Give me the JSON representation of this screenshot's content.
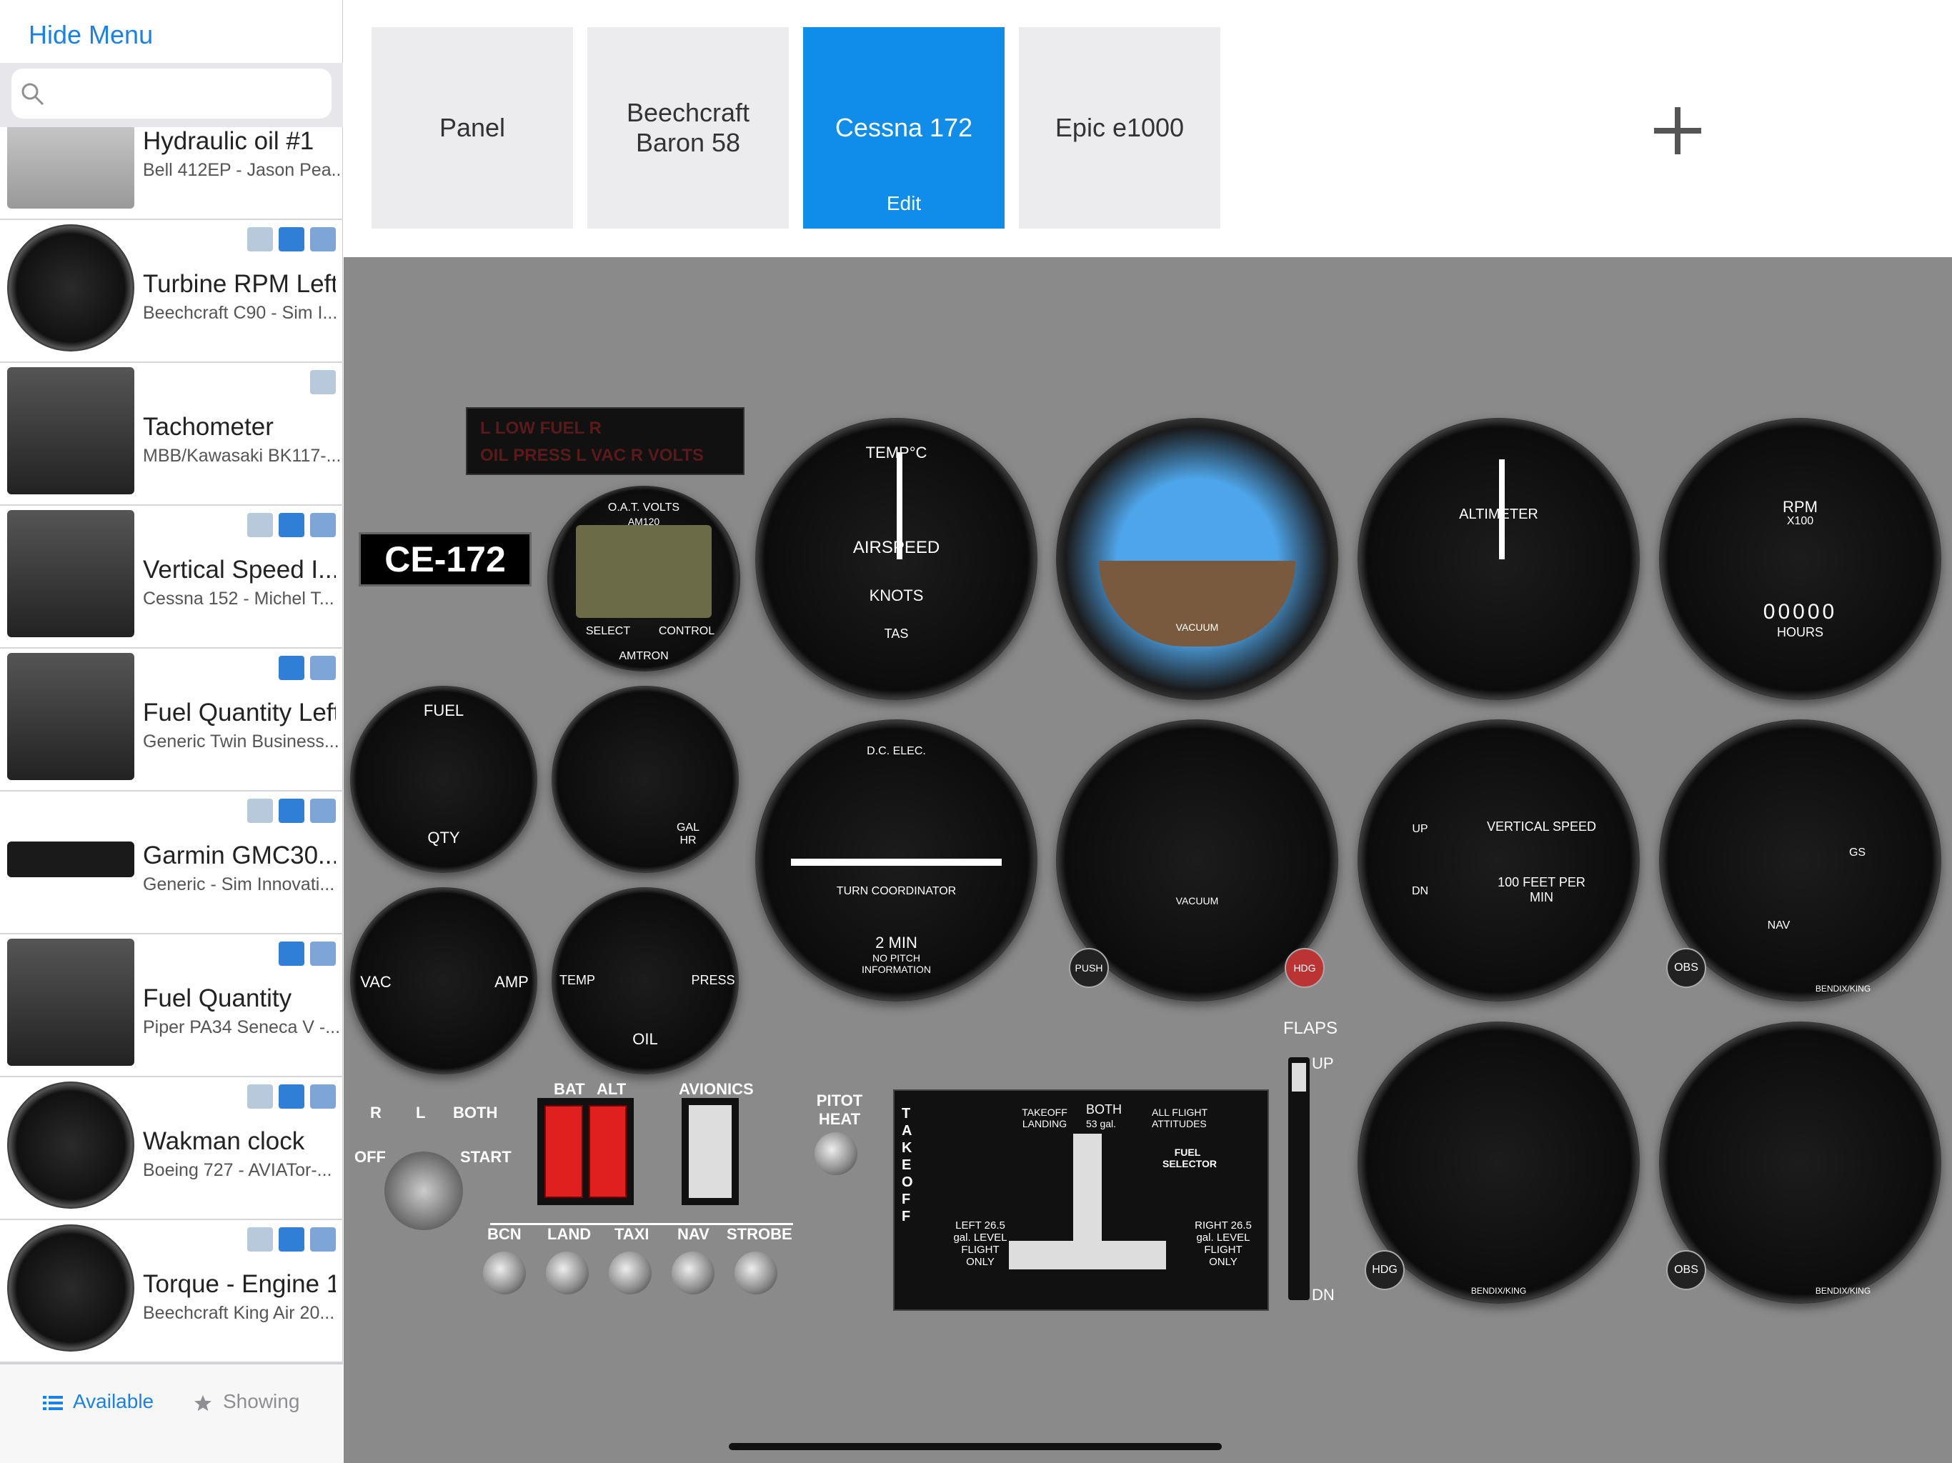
{
  "sidebar": {
    "hide_menu": "Hide Menu",
    "search_placeholder": "",
    "items": [
      {
        "title": "Hydraulic oil #1",
        "subtitle": "Bell 412EP - Jason Pea...",
        "badges": []
      },
      {
        "title": "Turbine RPM Left",
        "subtitle": "Beechcraft C90 - Sim I...",
        "badges": [
          "cloud",
          "plane",
          "p3d"
        ]
      },
      {
        "title": "Tachometer",
        "subtitle": "MBB/Kawasaki BK117-...",
        "badges": [
          "cloud"
        ]
      },
      {
        "title": "Vertical Speed I...",
        "subtitle": "Cessna 152 - Michel T...",
        "badges": [
          "cloud",
          "plane",
          "p3d"
        ]
      },
      {
        "title": "Fuel Quantity Left",
        "subtitle": "Generic Twin Business...",
        "badges": [
          "plane",
          "p3d"
        ]
      },
      {
        "title": "Garmin GMC30...",
        "subtitle": "Generic - Sim Innovati...",
        "badges": [
          "cloud",
          "plane",
          "p3d"
        ]
      },
      {
        "title": "Fuel Quantity",
        "subtitle": "Piper PA34 Seneca V -...",
        "badges": [
          "plane",
          "p3d"
        ]
      },
      {
        "title": "Wakman clock",
        "subtitle": "Boeing 727 - AVIATor-...",
        "badges": [
          "cloud",
          "plane",
          "p3d"
        ]
      },
      {
        "title": "Torque - Engine 1",
        "subtitle": "Beechcraft King Air 20...",
        "badges": [
          "cloud",
          "plane",
          "p3d"
        ]
      }
    ],
    "tabs": {
      "available": "Available",
      "showing": "Showing"
    }
  },
  "panel_tabs": [
    {
      "label": "Panel",
      "active": false
    },
    {
      "label": "Beechcraft Baron 58",
      "active": false
    },
    {
      "label": "Cessna 172",
      "active": true,
      "sub": "Edit"
    },
    {
      "label": "Epic e1000",
      "active": false
    }
  ],
  "panel": {
    "tail_label": "CE-172",
    "annunciator": {
      "line1": "L  LOW FUEL  R",
      "line2": "OIL PRESS  L  VAC  R  VOLTS"
    },
    "am120": {
      "top": "O.A.T.   VOLTS",
      "model": "AM120",
      "select": "SELECT",
      "control": "CONTROL",
      "brand": "AMTRON"
    },
    "gauges": {
      "airspeed": {
        "l1": "TEMP°C",
        "l2": "AIRSPEED",
        "l3": "KNOTS",
        "l4": "TAS"
      },
      "attitude": {
        "l1": "VACUUM"
      },
      "altimeter": {
        "l1": "ALTIMETER"
      },
      "tach": {
        "l1": "RPM",
        "l2": "X100",
        "l3": "HOURS",
        "counter": "00000"
      },
      "fuel_qty": {
        "l1": "FUEL",
        "l2": "QTY"
      },
      "egt": {
        "l1": "GAL",
        "l2": "HR"
      },
      "vac_amp": {
        "l1": "VAC",
        "l2": "AMP"
      },
      "oil": {
        "l1": "OIL",
        "l2": "TEMP",
        "l3": "PRESS"
      },
      "turn_coord": {
        "l1": "D.C. ELEC.",
        "l2": "TURN COORDINATOR",
        "l3": "2 MIN",
        "l4": "NO PITCH INFORMATION"
      },
      "heading": {
        "l1": "VACUUM",
        "push": "PUSH",
        "hdg": "HDG"
      },
      "vsi": {
        "l1": "VERTICAL SPEED",
        "l2": "100 FEET PER MIN",
        "up": "UP",
        "dn": "DN"
      },
      "nav1": {
        "obs": "OBS",
        "brand": "BENDIX/KING",
        "gs": "GS",
        "nav": "NAV"
      },
      "hsi": {
        "hdg": "HDG",
        "brand": "BENDIX/KING"
      },
      "nav2": {
        "obs": "OBS",
        "brand": "BENDIX/KING"
      }
    },
    "switches": {
      "key": {
        "r": "R",
        "l": "L",
        "both": "BOTH",
        "off": "OFF",
        "start": "START"
      },
      "bat": "BAT",
      "alt": "ALT",
      "avionics": "AVIONICS",
      "pitot": "PITOT HEAT",
      "toggles": [
        "BCN",
        "LAND",
        "TAXI",
        "NAV",
        "STROBE"
      ]
    },
    "fuel_selector": {
      "takeoff": "TAKEOFF LANDING",
      "both": "BOTH",
      "both_gal": "53 gal.",
      "all": "ALL FLIGHT ATTITUDES",
      "selector": "FUEL SELECTOR",
      "left": "LEFT 26.5 gal. LEVEL FLIGHT ONLY",
      "right": "RIGHT 26.5 gal. LEVEL FLIGHT ONLY",
      "takeoff_vertical": "TAKE OFF"
    },
    "flaps": {
      "title": "FLAPS",
      "up": "UP",
      "dn": "DN"
    }
  }
}
